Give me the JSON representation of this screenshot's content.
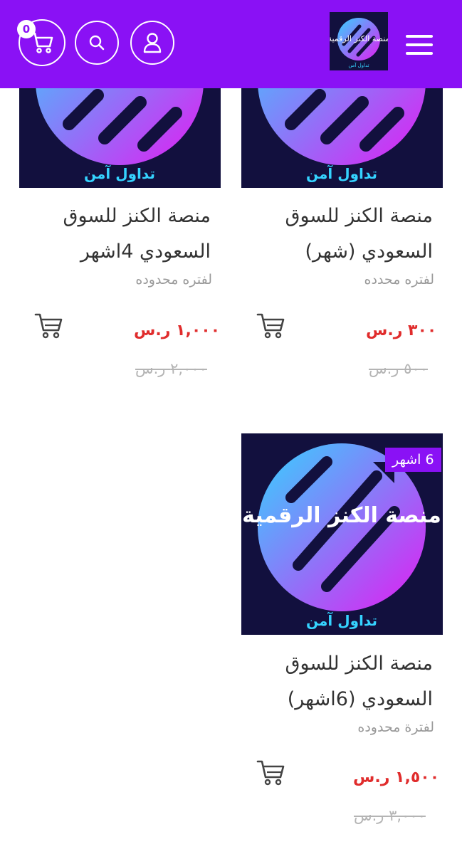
{
  "header": {
    "cart_count": "0",
    "logo_title": "منصة الكنز الرقمية",
    "logo_subtitle": "تداول آمن"
  },
  "products": [
    {
      "title_line1": "منصة الكنز للسوق",
      "title_line2": "السعودي (شهر)",
      "subtitle": "لفتره محدده",
      "price": "٣٠٠ ر.س",
      "old_price": "٥٠٠ ر.س",
      "image_caption": "تداول آمن"
    },
    {
      "title_line1": "منصة الكنز للسوق",
      "title_line2": "السعودي 4اشهر",
      "subtitle": "لفتره محدوده",
      "price": "١,٠٠٠ ر.س",
      "old_price": "٢,٠٠٠ ر.س",
      "image_caption": "تداول آمن"
    },
    {
      "title_line1": "منصة الكنز للسوق",
      "title_line2": "السعودي (6اشهر)",
      "subtitle": "لفترة محدوده",
      "price": "١,٥٠٠ ر.س",
      "old_price": "٣,٠٠٠ ر.س",
      "tag": "6 اشهر",
      "image_title": "منصة الكنز الرقمية",
      "image_caption": "تداول آمن"
    }
  ],
  "colors": {
    "brand": "#8a11f5",
    "price": "#e02c2c",
    "image_bg": "#12103e"
  }
}
